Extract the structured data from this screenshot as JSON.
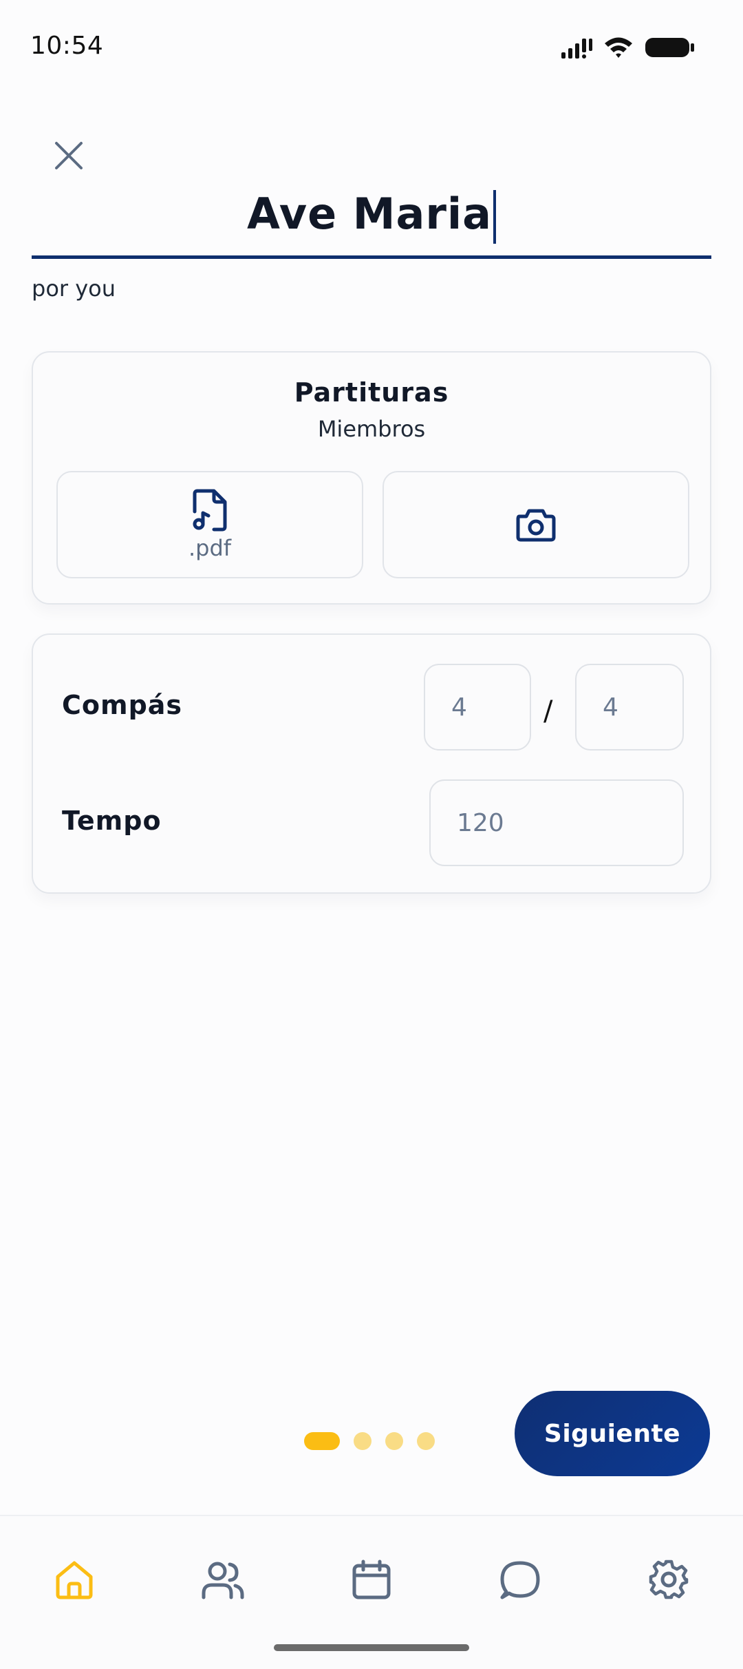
{
  "status_bar": {
    "time": "10:54"
  },
  "header": {
    "title": "Ave Maria",
    "author": "por you"
  },
  "scores_card": {
    "title": "Partituras",
    "subtitle": "Miembros",
    "pdf_label": ".pdf",
    "pdf_icon": "music-file-icon",
    "camera_icon": "camera-icon"
  },
  "meta_card": {
    "time_signature_label": "Compás",
    "time_signature_numerator": "4",
    "time_signature_separator": "/",
    "time_signature_denominator": "4",
    "tempo_label": "Tempo",
    "tempo_value": "120"
  },
  "pager": {
    "total_steps": 4,
    "current_step": 1
  },
  "next_button": {
    "label": "Siguiente"
  },
  "bottom_nav": {
    "items": [
      {
        "icon": "home-icon",
        "active": true
      },
      {
        "icon": "users-icon",
        "active": false
      },
      {
        "icon": "calendar-icon",
        "active": false
      },
      {
        "icon": "chat-icon",
        "active": false
      },
      {
        "icon": "settings-icon",
        "active": false
      }
    ]
  },
  "colors": {
    "primary": "#0f2f6e",
    "accent": "#fbbd14",
    "accent_light": "#f9dc85",
    "nav_inactive": "#5b6b82"
  }
}
